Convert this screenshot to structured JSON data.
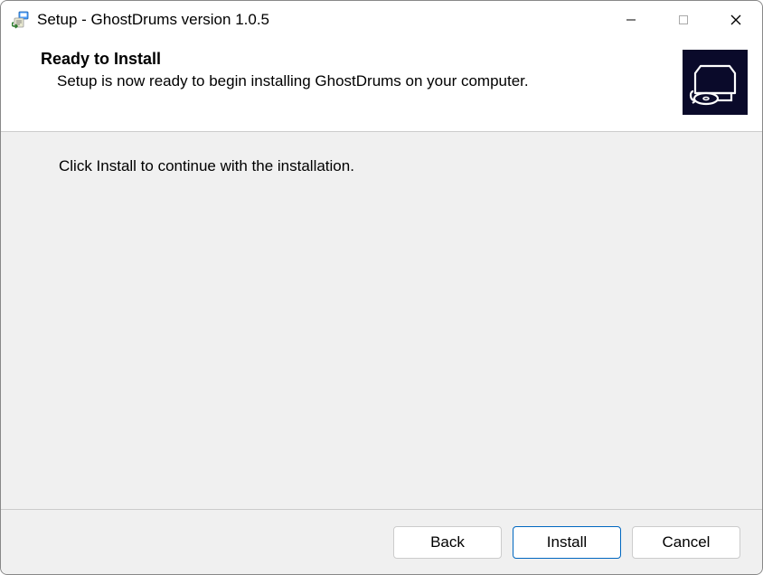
{
  "window": {
    "title": "Setup - GhostDrums version 1.0.5"
  },
  "header": {
    "heading": "Ready to Install",
    "subtext": "Setup is now ready to begin installing GhostDrums on your computer."
  },
  "content": {
    "instruction": "Click Install to continue with the installation."
  },
  "footer": {
    "back_label": "Back",
    "install_label": "Install",
    "cancel_label": "Cancel"
  },
  "icons": {
    "app": "installer-icon",
    "minimize": "minimize-icon",
    "maximize": "maximize-icon",
    "close": "close-icon",
    "header_image": "computer-disc-icon"
  }
}
